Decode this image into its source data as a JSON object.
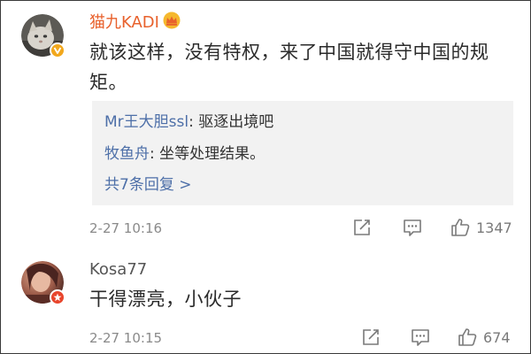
{
  "comments": [
    {
      "username": "猫九KADI",
      "username_color": "#e8612c",
      "crown_icon": "crown-icon",
      "badge_color": "#f2a81d",
      "badge_icon": "verified-v-icon",
      "text_line1": "就该这样，没有特权，来了中国就得守中国的规",
      "text_line2": "矩。",
      "replies": [
        {
          "user": "Mr王大胆ssl",
          "text": ": 驱逐出境吧"
        },
        {
          "user": "牧鱼舟",
          "text": ": 坐等处理结果。"
        }
      ],
      "more_replies": "共7条回复 >",
      "timestamp": "2-27 10:16",
      "like_count": "1347"
    },
    {
      "username": "Kosa77",
      "username_color": "#555555",
      "badge_color": "#e8452c",
      "badge_icon": "star-badge-icon",
      "text": "干得漂亮，小伙子",
      "timestamp": "2-27 10:15",
      "like_count": "674"
    }
  ]
}
